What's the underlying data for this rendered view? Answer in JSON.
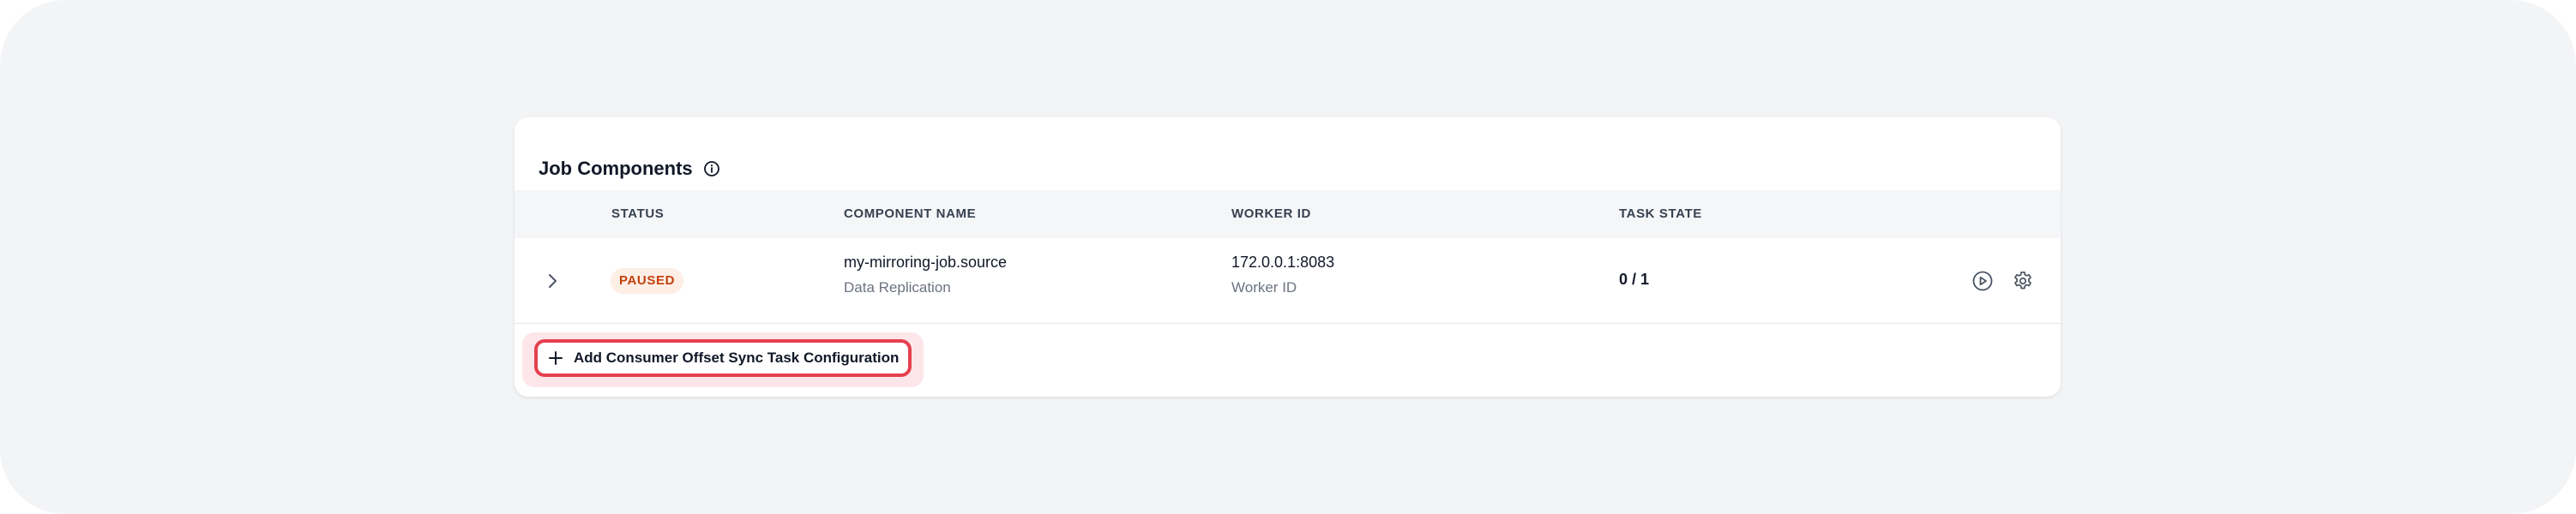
{
  "card": {
    "title": "Job Components"
  },
  "table": {
    "columns": {
      "status": "STATUS",
      "component_name": "COMPONENT NAME",
      "worker_id": "WORKER ID",
      "task_state": "TASK STATE"
    },
    "rows": [
      {
        "status": "PAUSED",
        "component_name": "my-mirroring-job.source",
        "component_type": "Data Replication",
        "worker_id": "172.0.0.1:8083",
        "worker_id_label": "Worker ID",
        "task_state": "0 / 1"
      }
    ]
  },
  "actions": {
    "add_label": "Add Consumer Offset Sync Task Configuration"
  },
  "colors": {
    "paused_badge_bg": "#fdeee6",
    "paused_badge_text": "#c2410c",
    "highlight_border": "#e5404f",
    "highlight_glow": "#fde6ea"
  },
  "icons": {
    "header_info": "info-icon",
    "row_expand": "chevron-right-icon",
    "row_resume": "play-circle-icon",
    "row_settings": "gear-icon",
    "add": "plus-icon"
  }
}
